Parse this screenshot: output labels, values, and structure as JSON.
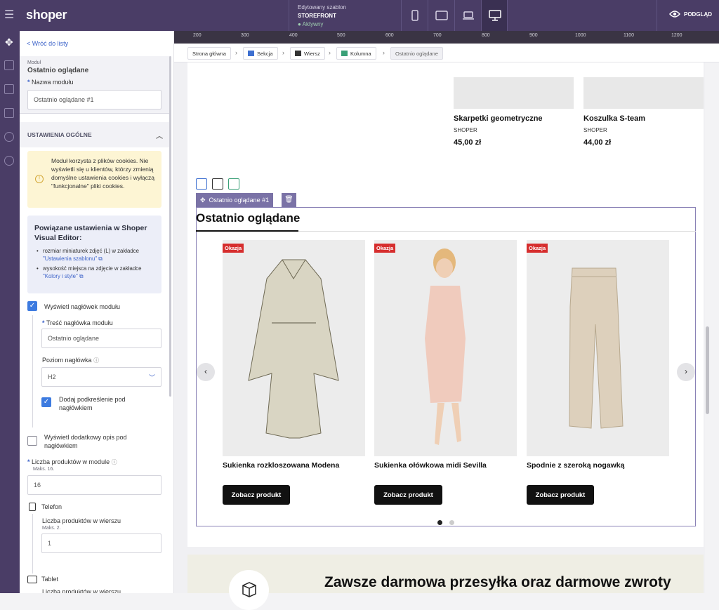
{
  "topbar": {
    "logo": "shoper",
    "template_label": "Edytowany szablon",
    "template_name": "STOREFRONT",
    "template_status": "● Aktywny",
    "preview_label": "PODGLĄD"
  },
  "panel": {
    "back_link": "< Wróć do listy",
    "module_label": "Moduł",
    "module_title": "Ostatnio oglądane",
    "name_label": "Nazwa modułu",
    "name_value": "Ostatnio oglądane #1",
    "section_title": "USTAWIENIA OGÓLNE",
    "cookie_warning": "Moduł korzysta z plików cookies. Nie wyświetli się u klientów, którzy zmienią domyślne ustawienia cookies i wyłączą \"funkcjonalne\" pliki cookies.",
    "related_title": "Powiązane ustawienia w Shoper Visual Editor:",
    "related_item1_text": "rozmiar miniaturek zdjęć (L) w zakładce",
    "related_item1_link": "\"Ustawienia szablonu\" ⧉",
    "related_item2_text": "wysokość miejsca na zdjęcie w zakładce",
    "related_item2_link": "\"Kolory i style\" ⧉",
    "show_header_label": "Wyświetl nagłówek modułu",
    "header_content_label": "Treść nagłówka modułu",
    "header_content_value": "Ostatnio oglądane",
    "header_level_label": "Poziom nagłówka",
    "header_level_value": "H2",
    "underline_label": "Dodaj podkreślenie pod nagłówkiem",
    "extra_desc_label": "Wyświetl dodatkowy opis pod nagłówkiem",
    "product_count_label": "Liczba produktów w module",
    "product_count_hint": "Maks. 16.",
    "product_count_value": "16",
    "phone_label": "Telefon",
    "per_row_label": "Liczba produktów w wierszu",
    "per_row_hint": "Maks. 2.",
    "per_row_value": "1",
    "tablet_label": "Tablet",
    "tablet_per_row_label": "Liczba produktów w wierszu"
  },
  "ruler": [
    "200",
    "300",
    "400",
    "500",
    "600",
    "700",
    "800",
    "900",
    "1000",
    "1100",
    "1200"
  ],
  "breadcrumb": [
    "Strona główna",
    "Sekcja",
    "Wiersz",
    "Kolumna",
    "Ostatnio oglądane"
  ],
  "top_products": [
    {
      "name": "Skarpetki geometryczne",
      "brand": "SHOPER",
      "price": "45,00 zł"
    },
    {
      "name": "Koszulka S-team",
      "brand": "SHOPER",
      "price": "44,00 zł"
    }
  ],
  "module": {
    "tag": "Ostatnio oglądane #1",
    "heading": "Ostatnio oglądane",
    "cards": [
      {
        "badge": "Okazja",
        "title": "Sukienka rozkloszowana Modena",
        "button": "Zobacz produkt"
      },
      {
        "badge": "Okazja",
        "title": "Sukienka ołówkowa midi Sevilla",
        "button": "Zobacz produkt"
      },
      {
        "badge": "Okazja",
        "title": "Spodnie z szeroką nogawką",
        "button": "Zobacz produkt"
      }
    ],
    "prev": "‹",
    "next": "›"
  },
  "banner": {
    "text": "Zawsze darmowa przesyłka oraz darmowe zwroty"
  }
}
